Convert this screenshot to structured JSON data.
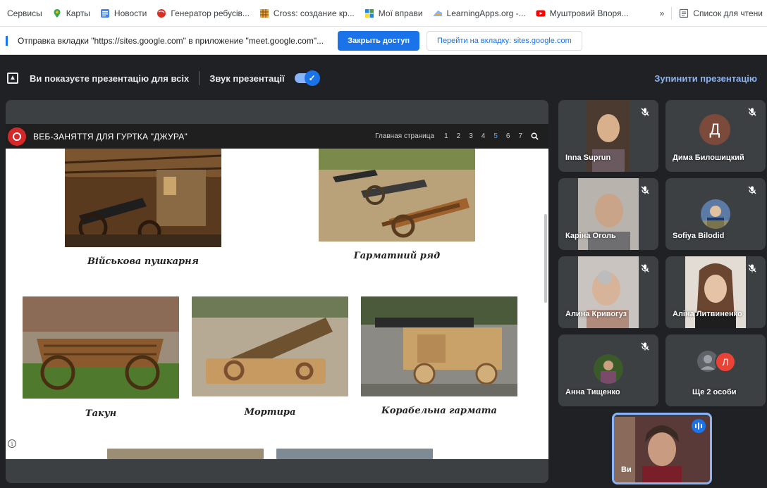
{
  "bookmarks": {
    "items": [
      {
        "label": "Сервисы",
        "icon": "apps-icon",
        "color": "#5f6368"
      },
      {
        "label": "Карты",
        "icon": "maps-pin-icon",
        "color": "#34a853"
      },
      {
        "label": "Новости",
        "icon": "news-icon",
        "color": "#4285f4"
      },
      {
        "label": "Генератор ребусів...",
        "icon": "rebus-icon",
        "color": "#d93025"
      },
      {
        "label": "Cross: создание кр...",
        "icon": "crossword-icon",
        "color": "#e8a33d"
      },
      {
        "label": "Мої вправи",
        "icon": "learningapps-icon",
        "color": "#1e88e5"
      },
      {
        "label": "LearningApps.org -...",
        "icon": "learningapps-org-icon",
        "color": "#8ab4f8"
      },
      {
        "label": "Муштровий Впоря...",
        "icon": "youtube-icon",
        "color": "#ff0000"
      }
    ],
    "overflow": "»",
    "reading_list": "Список для чтени"
  },
  "share_bar": {
    "message": "Отправка вкладки \"https://sites.google.com\" в приложение \"meet.google.com\"...",
    "stop_button": "Закрыть доступ",
    "goto_button": "Перейти на вкладку: sites.google.com"
  },
  "presenting_bar": {
    "status": "Ви показуєте презентацію для всіх",
    "audio_label": "Звук презентації",
    "audio_on": true,
    "stop_link": "Зупинити презентацію"
  },
  "site": {
    "title": "ВЕБ-ЗАНЯТТЯ ДЛЯ ГУРТКА \"ДЖУРА\"",
    "nav_home": "Главная страница",
    "nav_pages": [
      "1",
      "2",
      "3",
      "4",
      "5",
      "6",
      "7"
    ],
    "active_page": "5",
    "captions": {
      "gunhouse": "Військова пушкарня",
      "cannon_row": "Гарматний ряд",
      "takun": "Такун",
      "mortar": "Мортира",
      "ship_cannon": "Корабельна гармата"
    }
  },
  "participants": [
    {
      "name": "Inna Suprun",
      "type": "video",
      "muted": true
    },
    {
      "name": "Дима Билошицкий",
      "type": "letter",
      "letter": "Д",
      "muted": true
    },
    {
      "name": "Каріна Оголь",
      "type": "video",
      "muted": true
    },
    {
      "name": "Sofiya Bilodid",
      "type": "photo",
      "muted": true
    },
    {
      "name": "Алина Кривогуз",
      "type": "video",
      "muted": true
    },
    {
      "name": "Аліна Литвиненко",
      "type": "video",
      "muted": true
    },
    {
      "name": "Анна Тищенко",
      "type": "photo",
      "muted": true
    },
    {
      "name": "Ще 2 особи",
      "type": "more",
      "letter": "Л"
    }
  ],
  "self": {
    "name": "Ви",
    "speaking": true
  },
  "colors": {
    "accent": "#1a73e8",
    "link": "#8ab4f8",
    "bg": "#202124",
    "tile": "#3c4043"
  }
}
